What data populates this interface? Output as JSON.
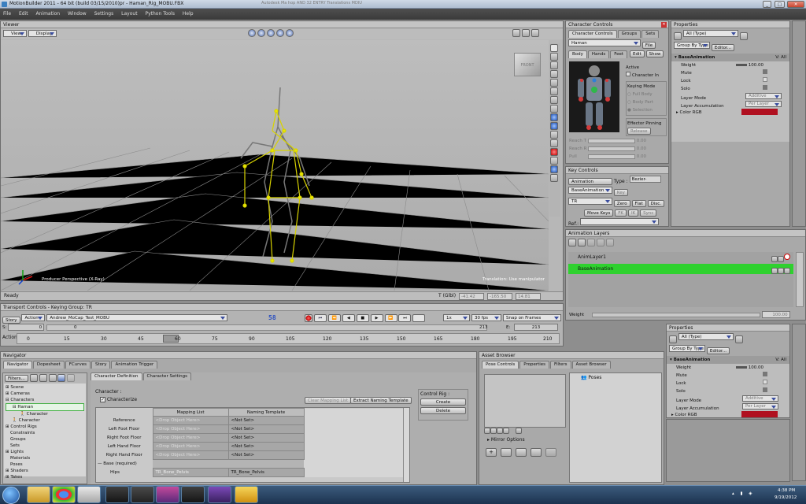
{
  "app": {
    "title": "MotionBuilder 2011  -  64 bit (build 03/15/2010)pr  -  Haman_Rig_MOBU.FBX",
    "overlay_text": "Autodesk Ma hop  AND 32  ENTRY  Translations MDIU",
    "win_min": "_",
    "win_max": "□",
    "win_close": "✕"
  },
  "menubar": [
    "File",
    "Edit",
    "Animation",
    "Window",
    "Settings",
    "Layout",
    "Python Tools",
    "Help"
  ],
  "viewer": {
    "title": "Viewer",
    "view_btn": "View",
    "display_btn": "Display",
    "camera_label": "Producer Perspective (X-Ray)",
    "manip_label": "Translation: Use manipulator",
    "cube_label": "FRONT",
    "status": "Ready",
    "t_label": "T (Glbl)",
    "t_values": [
      "-41.42",
      "-165.50",
      "14.81"
    ]
  },
  "char_controls": {
    "title": "Character Controls",
    "tabs": [
      "Character Controls",
      "Groups",
      "Sets"
    ],
    "character": "Haman",
    "file_btn": "File",
    "subtabs": [
      "Body",
      "Hands",
      "Feet"
    ],
    "edit_btn": "Edit",
    "show_btn": "Show",
    "active_label": "Active",
    "character_in": "Character In",
    "keying_mode_label": "Keying Mode",
    "keying_modes": [
      "Full Body",
      "Body Part",
      "Selection"
    ],
    "effector_pinning": "Effector Pinning",
    "release_btn": "Release",
    "sliders": [
      {
        "label": "Reach T",
        "value": "0.00"
      },
      {
        "label": "Reach R",
        "value": "0.00"
      },
      {
        "label": "Pull",
        "value": "0.00"
      }
    ]
  },
  "key_controls": {
    "title": "Key Controls",
    "animation_btn": "Animation",
    "type_label": "Type :",
    "type_value": "Bezier-Clamp",
    "layer_value": "BaseAnimation",
    "key_btn": "Key",
    "tr_value": "TR",
    "zero_btn": "Zero",
    "flat_btn": "Flat",
    "disc_btn": "Disc.",
    "move_keys_btn": "Move Keys",
    "fk_btn": "FK",
    "ik_btn": "IK",
    "sync_btn": "Sync",
    "ref_label": "Ref.:"
  },
  "properties_top": {
    "title": "Properties",
    "filter": "All (Type)",
    "group_by": "Group By Type",
    "editor": "Editor...",
    "section": "BaseAnimation",
    "va_label": "V: All",
    "rows": [
      {
        "label": "Weight",
        "value": "100.00"
      },
      {
        "label": "Mute",
        "value": ""
      },
      {
        "label": "Lock",
        "value": ""
      },
      {
        "label": "Solo",
        "value": ""
      },
      {
        "label": "Layer Mode",
        "value": "Additive"
      },
      {
        "label": "Layer Accumulation",
        "value": "Per Layer"
      },
      {
        "label": "Color RGB",
        "value": ""
      }
    ],
    "color_hex": "#b01020"
  },
  "anim_layers": {
    "title": "Animation Layers",
    "layers": [
      "AnimLayer1",
      "BaseAnimation"
    ],
    "weight_label": "Weight",
    "weight_value": "100.00"
  },
  "properties_bottom": {
    "title": "Properties",
    "filter": "All (Type)",
    "group_by": "Group By Type",
    "editor": "Editor...",
    "section": "BaseAnimation",
    "va_label": "V: All",
    "rows": [
      {
        "label": "Weight",
        "value": "100.00"
      },
      {
        "label": "Mute",
        "value": ""
      },
      {
        "label": "Lock",
        "value": ""
      },
      {
        "label": "Solo",
        "value": ""
      },
      {
        "label": "Layer Mode",
        "value": "Additive"
      },
      {
        "label": "Layer Accumulation",
        "value": "Per Layer"
      },
      {
        "label": "Color RGB",
        "value": ""
      }
    ]
  },
  "transport": {
    "title": "Transport Controls  -  Keying Group: TR",
    "story_btn": "Story",
    "action_btn": "Action",
    "take": "Andrew_MoCap_Test_MOBU",
    "frame": "58",
    "speed": "1x",
    "fps": "30 fps",
    "snap": "Snap on Frames",
    "s_label": "S:",
    "s_value": "0",
    "e_label": "E:",
    "e_value": "213",
    "start_value": "0",
    "end_value": "213",
    "action_label": "Action",
    "ticks": [
      "0",
      "15",
      "30",
      "45",
      "60",
      "75",
      "90",
      "105",
      "120",
      "135",
      "150",
      "165",
      "180",
      "195",
      "210"
    ]
  },
  "navigator": {
    "title": "Navigator",
    "tabs": [
      "Navigator",
      "Dopesheet",
      "FCurves",
      "Story",
      "Animation Trigger"
    ],
    "filters_btn": "Filters...",
    "tree": [
      "Scene",
      "Cameras",
      "Characters",
      "Haman",
      "Character",
      "Character",
      "Control Rigs",
      "Constraints",
      "Groups",
      "Sets",
      "Lights",
      "Materials",
      "Poses",
      "Shaders",
      "Takes"
    ],
    "subtabs": [
      "Character Definition",
      "Character Settings"
    ],
    "character_label": "Character :",
    "characterize": "Characterize",
    "clear_mapping": "Clear Mapping List",
    "extract_template": "Extract Naming Template",
    "control_rig_label": "Control Rig :",
    "create_btn": "Create",
    "delete_btn": "Delete",
    "col_mapping": "Mapping List",
    "col_template": "Naming Template",
    "mapping_rows": [
      {
        "name": "Reference",
        "drop": "<Drop Object Here>",
        "tmpl": "<Not Set>"
      },
      {
        "name": "Left Foot Floor",
        "drop": "<Drop Object Here>",
        "tmpl": "<Not Set>"
      },
      {
        "name": "Right Foot Floor",
        "drop": "<Drop Object Here>",
        "tmpl": "<Not Set>"
      },
      {
        "name": "Left Hand Floor",
        "drop": "<Drop Object Here>",
        "tmpl": "<Not Set>"
      },
      {
        "name": "Right Hand Floor",
        "drop": "<Drop Object Here>",
        "tmpl": "<Not Set>"
      },
      {
        "name": "Base (required)",
        "drop": "",
        "tmpl": ""
      },
      {
        "name": "Hips",
        "drop": "TR_Bone_Pelvis",
        "tmpl": "TR_Bone_Pelvis"
      }
    ]
  },
  "asset_browser": {
    "title": "Asset Browser",
    "tabs": [
      "Pose Controls",
      "Properties",
      "Filters",
      "Asset Browser"
    ],
    "poses": "Poses",
    "mirror": "Mirror Options"
  },
  "taskbar": {
    "time": "4:38 PM",
    "date": "9/19/2012"
  }
}
